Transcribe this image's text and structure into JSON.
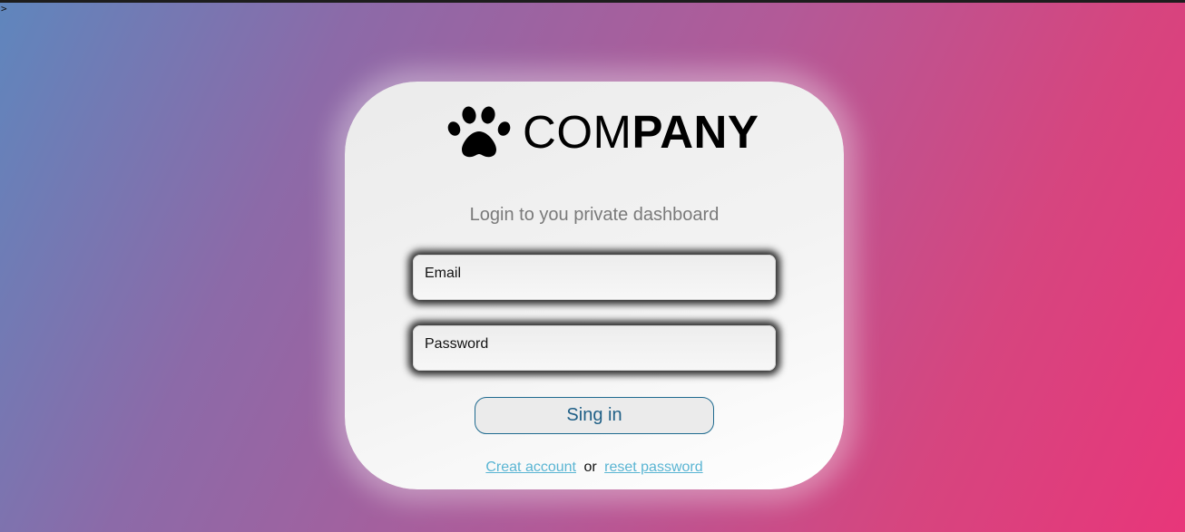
{
  "stray_text": ">",
  "brand": {
    "icon": "paw-icon",
    "name_light": "COM",
    "name_bold": "PANY"
  },
  "subtitle": "Login to you private dashboard",
  "form": {
    "email_placeholder": "Email",
    "password_placeholder": "Password",
    "submit_label": "Sing in"
  },
  "footer": {
    "create_account_label": "Creat account",
    "separator": "or",
    "reset_password_label": "reset password"
  },
  "colors": {
    "gradient_start": "#5f86bd",
    "gradient_end": "#e8367a",
    "button_text": "#1f5f86",
    "link": "#5ab5d3"
  }
}
